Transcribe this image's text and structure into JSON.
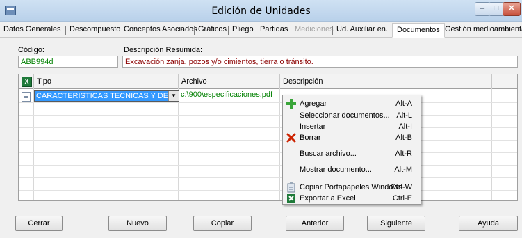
{
  "window": {
    "title": "Edición de Unidades",
    "min_glyph": "–",
    "max_glyph": "□",
    "close_glyph": "✕"
  },
  "tabs": [
    {
      "label": "Datos Generales"
    },
    {
      "label": "Descompuesto"
    },
    {
      "label": "Conceptos Asociados"
    },
    {
      "label": "Gráficos"
    },
    {
      "label": "Pliego"
    },
    {
      "label": "Partidas"
    },
    {
      "label": "Mediciones"
    },
    {
      "label": "Ud. Auxiliar en..."
    },
    {
      "label": "Documentos"
    },
    {
      "label": "Gestión medioambiental"
    }
  ],
  "form": {
    "codigo_label": "Código:",
    "codigo_value": "ABB994d",
    "descripcion_label": "Descripción Resumida:",
    "descripcion_value": "Excavación zanja, pozos y/o cimientos, tierra o tránsito."
  },
  "grid": {
    "columns": [
      "Tipo",
      "Archivo",
      "Descripción"
    ],
    "rows": [
      {
        "tipo": "CARACTERISTICAS TECNICAS Y DE FABRICA",
        "archivo": "c:\\900\\especificaciones.pdf",
        "descripcion": ""
      }
    ]
  },
  "context_menu": {
    "items": [
      {
        "label": "Agregar",
        "shortcut": "Alt-A",
        "icon": "plus-icon"
      },
      {
        "label": "Seleccionar documentos...",
        "shortcut": "Alt-L",
        "icon": ""
      },
      {
        "label": "Insertar",
        "shortcut": "Alt-I",
        "icon": ""
      },
      {
        "label": "Borrar",
        "shortcut": "Alt-B",
        "icon": "delete-x-icon"
      },
      {
        "label": "Buscar archivo...",
        "shortcut": "Alt-R",
        "icon": ""
      },
      {
        "label": "Mostrar documento...",
        "shortcut": "Alt-M",
        "icon": ""
      },
      {
        "label": "Copiar Portapapeles Windows",
        "shortcut": "Ctrl-W",
        "icon": "clipboard-icon"
      },
      {
        "label": "Exportar a Excel",
        "shortcut": "Ctrl-E",
        "icon": "excel-icon"
      }
    ]
  },
  "buttons": [
    "Cerrar",
    "Nuevo",
    "Copiar",
    "Anterior",
    "Siguiente",
    "Ayuda"
  ],
  "colors": {
    "accent_green": "#008000",
    "accent_red": "#8b0000",
    "selection": "#3399ff"
  }
}
